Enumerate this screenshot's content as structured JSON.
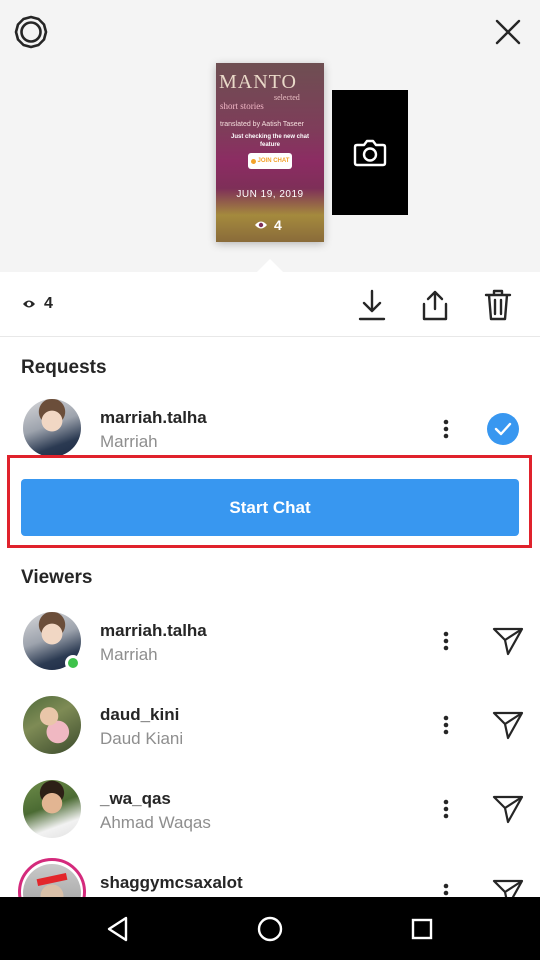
{
  "story_preview": {
    "book_title": "MANTO",
    "book_subtitle_1": "selected",
    "book_subtitle_2": "short stories",
    "book_translator": "translated by Aatish Taseer",
    "caption": "Just checking the new chat feature",
    "sticker_label": "JOIN CHAT",
    "date": "JUN 19, 2019",
    "view_count": "4"
  },
  "action_bar": {
    "view_count": "4"
  },
  "requests": {
    "title": "Requests",
    "items": [
      {
        "username": "marriah.talha",
        "fullname": "Marriah",
        "selected": true
      }
    ]
  },
  "start_chat": {
    "label": "Start Chat"
  },
  "viewers": {
    "title": "Viewers",
    "items": [
      {
        "username": "marriah.talha",
        "fullname": "Marriah",
        "online": true
      },
      {
        "username": "daud_kini",
        "fullname": "Daud Kiani",
        "online": false
      },
      {
        "username": "_wa_qas",
        "fullname": "Ahmad Waqas",
        "online": false
      },
      {
        "username": "shaggymcsaxalot",
        "fullname": "",
        "online": false,
        "has_story_ring": true
      }
    ]
  },
  "colors": {
    "accent": "#3897f0",
    "highlight_border": "#e0222c",
    "online": "#3ec24b",
    "story_ring": "#d42a7c"
  }
}
